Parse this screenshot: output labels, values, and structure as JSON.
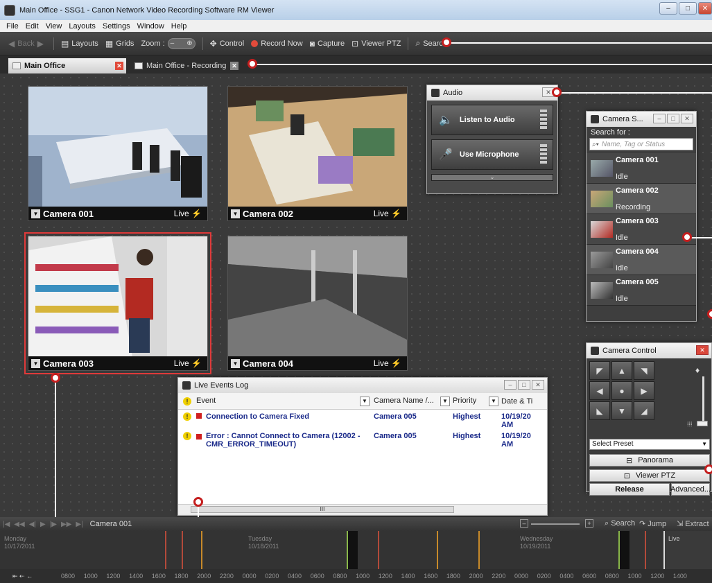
{
  "window": {
    "title": "Main Office - SSG1 - Canon Network Video Recording Software RM Viewer",
    "minimize": "–",
    "maximize": "□",
    "close": "✕"
  },
  "menu": [
    "File",
    "Edit",
    "View",
    "Layouts",
    "Settings",
    "Window",
    "Help"
  ],
  "toolbar": {
    "back": "Back",
    "layouts": "Layouts",
    "grids": "Grids",
    "zoom_label": "Zoom :",
    "control": "Control",
    "record_now": "Record Now",
    "capture": "Capture",
    "viewer_ptz": "Viewer PTZ",
    "search": "Search",
    "colors": {
      "record": "#e24b3b"
    }
  },
  "tabs": [
    {
      "label": "Main Office",
      "active": true
    },
    {
      "label": "Main Office - Recording",
      "active": false
    }
  ],
  "cameras": [
    {
      "name": "Camera 001",
      "live": "Live"
    },
    {
      "name": "Camera 002",
      "live": "Live"
    },
    {
      "name": "Camera 003",
      "live": "Live"
    },
    {
      "name": "Camera 004",
      "live": "Live"
    }
  ],
  "audio": {
    "title": "Audio",
    "listen": "Listen to Audio",
    "microphone": "Use Microphone"
  },
  "camera_search": {
    "title": "Camera S...",
    "search_for": "Search for :",
    "placeholder": "Name, Tag or Status",
    "items": [
      {
        "name": "Camera 001",
        "status": "Idle"
      },
      {
        "name": "Camera 002",
        "status": "Recording"
      },
      {
        "name": "Camera 003",
        "status": "Idle"
      },
      {
        "name": "Camera 004",
        "status": "Idle"
      },
      {
        "name": "Camera 005",
        "status": "Idle"
      }
    ]
  },
  "events": {
    "title": "Live Events Log",
    "columns": {
      "event": "Event",
      "camera": "Camera Name /...",
      "priority": "Priority",
      "date": "Date & Ti"
    },
    "rows": [
      {
        "event": "Connection to Camera Fixed",
        "camera": "Camera 005",
        "priority": "Highest",
        "date": "10/19/20 AM"
      },
      {
        "event": "Error : Cannot Connect to Camera (12002 - CMR_ERROR_TIMEOUT)",
        "camera": "Camera 005",
        "priority": "Highest",
        "date": "10/19/20 AM"
      }
    ],
    "scroll_grip": "III"
  },
  "camera_control": {
    "title": "Camera Control",
    "select_preset": "Select Preset",
    "panorama": "Panorama",
    "viewer_ptz": "Viewer PTZ",
    "release": "Release",
    "advanced": "Advanced..."
  },
  "timeline": {
    "camera": "Camera 001",
    "search": "Search",
    "jump": "Jump",
    "extract": "Extract",
    "live": "Live",
    "days": [
      {
        "day": "Monday",
        "date": "10/17/2011"
      },
      {
        "day": "Tuesday",
        "date": "10/18/2011"
      },
      {
        "day": "Wednesday",
        "date": "10/19/2011"
      }
    ],
    "ticks": [
      "0800",
      "1000",
      "1200",
      "1400",
      "1600",
      "1800",
      "2000",
      "2200",
      "0000",
      "0200",
      "0400",
      "0600",
      "0800",
      "1000",
      "1200",
      "1400",
      "1600",
      "1800",
      "2000",
      "2200",
      "0000",
      "0200",
      "0400",
      "0600",
      "0800",
      "1000",
      "1200",
      "1400"
    ]
  }
}
